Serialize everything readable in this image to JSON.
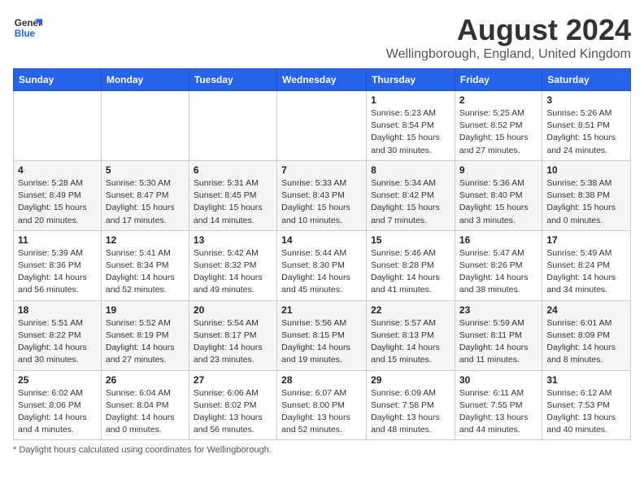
{
  "logo": {
    "line1": "General",
    "line2": "Blue"
  },
  "header": {
    "month": "August 2024",
    "location": "Wellingborough, England, United Kingdom"
  },
  "days_of_week": [
    "Sunday",
    "Monday",
    "Tuesday",
    "Wednesday",
    "Thursday",
    "Friday",
    "Saturday"
  ],
  "weeks": [
    [
      {
        "day": "",
        "info": ""
      },
      {
        "day": "",
        "info": ""
      },
      {
        "day": "",
        "info": ""
      },
      {
        "day": "",
        "info": ""
      },
      {
        "day": "1",
        "info": "Sunrise: 5:23 AM\nSunset: 8:54 PM\nDaylight: 15 hours\nand 30 minutes."
      },
      {
        "day": "2",
        "info": "Sunrise: 5:25 AM\nSunset: 8:52 PM\nDaylight: 15 hours\nand 27 minutes."
      },
      {
        "day": "3",
        "info": "Sunrise: 5:26 AM\nSunset: 8:51 PM\nDaylight: 15 hours\nand 24 minutes."
      }
    ],
    [
      {
        "day": "4",
        "info": "Sunrise: 5:28 AM\nSunset: 8:49 PM\nDaylight: 15 hours\nand 20 minutes."
      },
      {
        "day": "5",
        "info": "Sunrise: 5:30 AM\nSunset: 8:47 PM\nDaylight: 15 hours\nand 17 minutes."
      },
      {
        "day": "6",
        "info": "Sunrise: 5:31 AM\nSunset: 8:45 PM\nDaylight: 15 hours\nand 14 minutes."
      },
      {
        "day": "7",
        "info": "Sunrise: 5:33 AM\nSunset: 8:43 PM\nDaylight: 15 hours\nand 10 minutes."
      },
      {
        "day": "8",
        "info": "Sunrise: 5:34 AM\nSunset: 8:42 PM\nDaylight: 15 hours\nand 7 minutes."
      },
      {
        "day": "9",
        "info": "Sunrise: 5:36 AM\nSunset: 8:40 PM\nDaylight: 15 hours\nand 3 minutes."
      },
      {
        "day": "10",
        "info": "Sunrise: 5:38 AM\nSunset: 8:38 PM\nDaylight: 15 hours\nand 0 minutes."
      }
    ],
    [
      {
        "day": "11",
        "info": "Sunrise: 5:39 AM\nSunset: 8:36 PM\nDaylight: 14 hours\nand 56 minutes."
      },
      {
        "day": "12",
        "info": "Sunrise: 5:41 AM\nSunset: 8:34 PM\nDaylight: 14 hours\nand 52 minutes."
      },
      {
        "day": "13",
        "info": "Sunrise: 5:42 AM\nSunset: 8:32 PM\nDaylight: 14 hours\nand 49 minutes."
      },
      {
        "day": "14",
        "info": "Sunrise: 5:44 AM\nSunset: 8:30 PM\nDaylight: 14 hours\nand 45 minutes."
      },
      {
        "day": "15",
        "info": "Sunrise: 5:46 AM\nSunset: 8:28 PM\nDaylight: 14 hours\nand 41 minutes."
      },
      {
        "day": "16",
        "info": "Sunrise: 5:47 AM\nSunset: 8:26 PM\nDaylight: 14 hours\nand 38 minutes."
      },
      {
        "day": "17",
        "info": "Sunrise: 5:49 AM\nSunset: 8:24 PM\nDaylight: 14 hours\nand 34 minutes."
      }
    ],
    [
      {
        "day": "18",
        "info": "Sunrise: 5:51 AM\nSunset: 8:22 PM\nDaylight: 14 hours\nand 30 minutes."
      },
      {
        "day": "19",
        "info": "Sunrise: 5:52 AM\nSunset: 8:19 PM\nDaylight: 14 hours\nand 27 minutes."
      },
      {
        "day": "20",
        "info": "Sunrise: 5:54 AM\nSunset: 8:17 PM\nDaylight: 14 hours\nand 23 minutes."
      },
      {
        "day": "21",
        "info": "Sunrise: 5:56 AM\nSunset: 8:15 PM\nDaylight: 14 hours\nand 19 minutes."
      },
      {
        "day": "22",
        "info": "Sunrise: 5:57 AM\nSunset: 8:13 PM\nDaylight: 14 hours\nand 15 minutes."
      },
      {
        "day": "23",
        "info": "Sunrise: 5:59 AM\nSunset: 8:11 PM\nDaylight: 14 hours\nand 11 minutes."
      },
      {
        "day": "24",
        "info": "Sunrise: 6:01 AM\nSunset: 8:09 PM\nDaylight: 14 hours\nand 8 minutes."
      }
    ],
    [
      {
        "day": "25",
        "info": "Sunrise: 6:02 AM\nSunset: 8:06 PM\nDaylight: 14 hours\nand 4 minutes."
      },
      {
        "day": "26",
        "info": "Sunrise: 6:04 AM\nSunset: 8:04 PM\nDaylight: 14 hours\nand 0 minutes."
      },
      {
        "day": "27",
        "info": "Sunrise: 6:06 AM\nSunset: 8:02 PM\nDaylight: 13 hours\nand 56 minutes."
      },
      {
        "day": "28",
        "info": "Sunrise: 6:07 AM\nSunset: 8:00 PM\nDaylight: 13 hours\nand 52 minutes."
      },
      {
        "day": "29",
        "info": "Sunrise: 6:09 AM\nSunset: 7:58 PM\nDaylight: 13 hours\nand 48 minutes."
      },
      {
        "day": "30",
        "info": "Sunrise: 6:11 AM\nSunset: 7:55 PM\nDaylight: 13 hours\nand 44 minutes."
      },
      {
        "day": "31",
        "info": "Sunrise: 6:12 AM\nSunset: 7:53 PM\nDaylight: 13 hours\nand 40 minutes."
      }
    ]
  ],
  "footer": {
    "note": "Daylight hours"
  }
}
